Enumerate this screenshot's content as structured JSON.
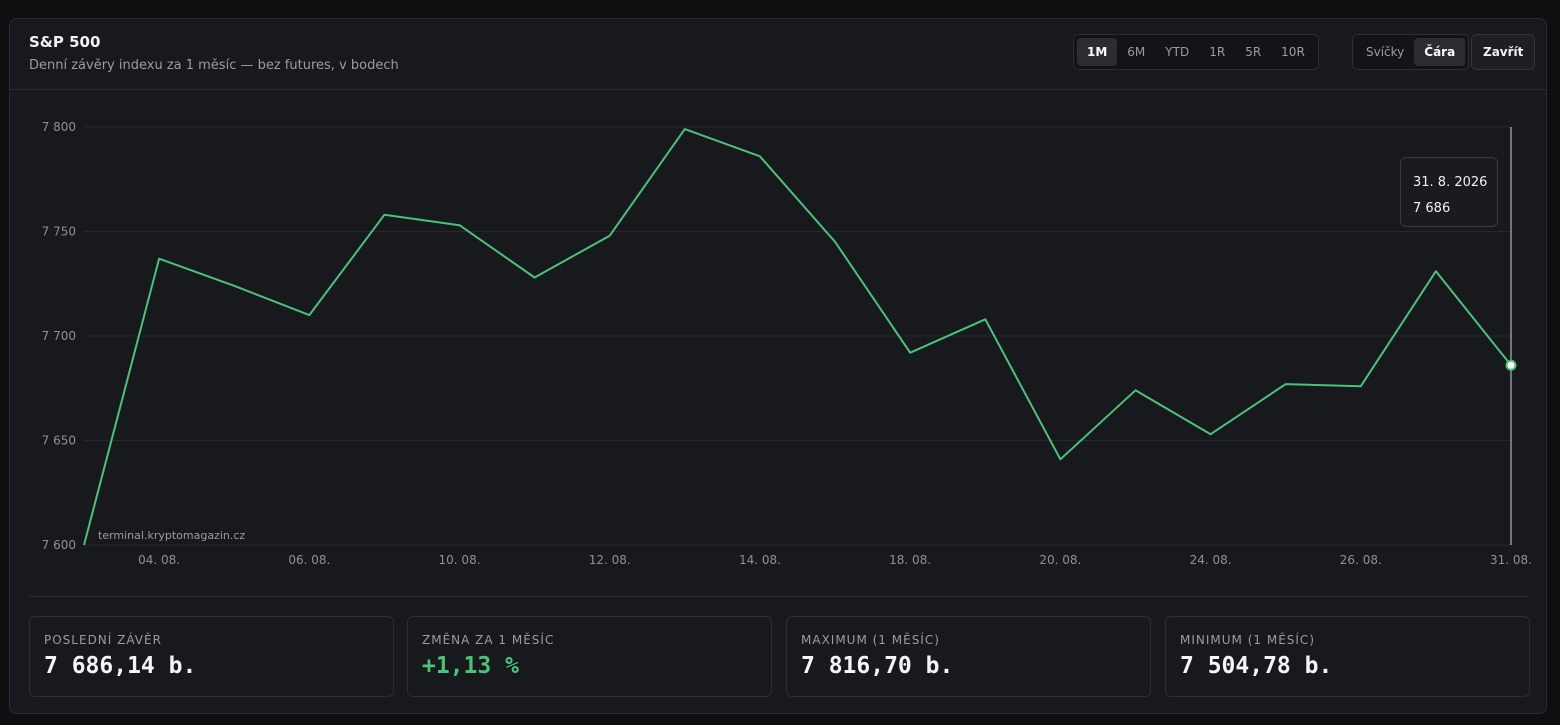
{
  "header": {
    "title": "S&P 500",
    "subtitle": "Denní závěry indexu za 1 měsíc — bez futures, v bodech"
  },
  "range_tabs": [
    {
      "label": "1M",
      "active": true
    },
    {
      "label": "6M",
      "active": false
    },
    {
      "label": "YTD",
      "active": false
    },
    {
      "label": "1R",
      "active": false
    },
    {
      "label": "5R",
      "active": false
    },
    {
      "label": "10R",
      "active": false
    }
  ],
  "mode_tabs": [
    {
      "label": "Svíčky",
      "active": false
    },
    {
      "label": "Čára",
      "active": true
    }
  ],
  "close_label": "Zavřít",
  "tooltip": {
    "date": "31. 8. 2026",
    "value": "7 686"
  },
  "watermark": "terminal.kryptomagazin.cz",
  "stats": [
    {
      "label": "POSLEDNÍ ZÁVĚR",
      "value": "7 686,14 b.",
      "positive": false
    },
    {
      "label": "ZMĚNA ZA 1 MĚSÍC",
      "value": "+1,13 %",
      "positive": true
    },
    {
      "label": "MAXIMUM (1 MĚSÍC)",
      "value": "7 816,70 b.",
      "positive": false
    },
    {
      "label": "MINIMUM (1 MĚSÍC)",
      "value": "7 504,78 b.",
      "positive": false
    }
  ],
  "colors": {
    "line": "#49c27a",
    "grid": "#26282c",
    "axis_text": "#8e9097",
    "crosshair": "#cfd1d5",
    "positive": "#49c27a"
  },
  "chart_data": {
    "type": "line",
    "title": "",
    "xlabel": "",
    "ylabel": "",
    "ylim": [
      7600,
      7800
    ],
    "yticks": [
      7600,
      7650,
      7700,
      7750,
      7800
    ],
    "ytick_labels": [
      "7 600",
      "7 650",
      "7 700",
      "7 750",
      "7 800"
    ],
    "x": [
      "03. 08.",
      "04. 08.",
      "05. 08.",
      "06. 08.",
      "07. 08.",
      "10. 08.",
      "11. 08.",
      "12. 08.",
      "13. 08.",
      "14. 08.",
      "17. 08.",
      "18. 08.",
      "19. 08.",
      "20. 08.",
      "21. 08.",
      "24. 08.",
      "25. 08.",
      "26. 08.",
      "27. 08.",
      "31. 08."
    ],
    "xtick_labels": [
      "04. 08.",
      "06. 08.",
      "10. 08.",
      "12. 08.",
      "14. 08.",
      "18. 08.",
      "20. 08.",
      "24. 08.",
      "26. 08.",
      "31. 08."
    ],
    "series": [
      {
        "values": [
          7600,
          7737,
          7724,
          7710,
          7758,
          7753,
          7728,
          7748,
          7799,
          7786,
          7745,
          7692,
          7708,
          7641,
          7674,
          7653,
          7677,
          7676,
          7731,
          7686
        ]
      }
    ],
    "grid": true,
    "highlight": {
      "x": "31. 08.",
      "value": 7686
    }
  }
}
